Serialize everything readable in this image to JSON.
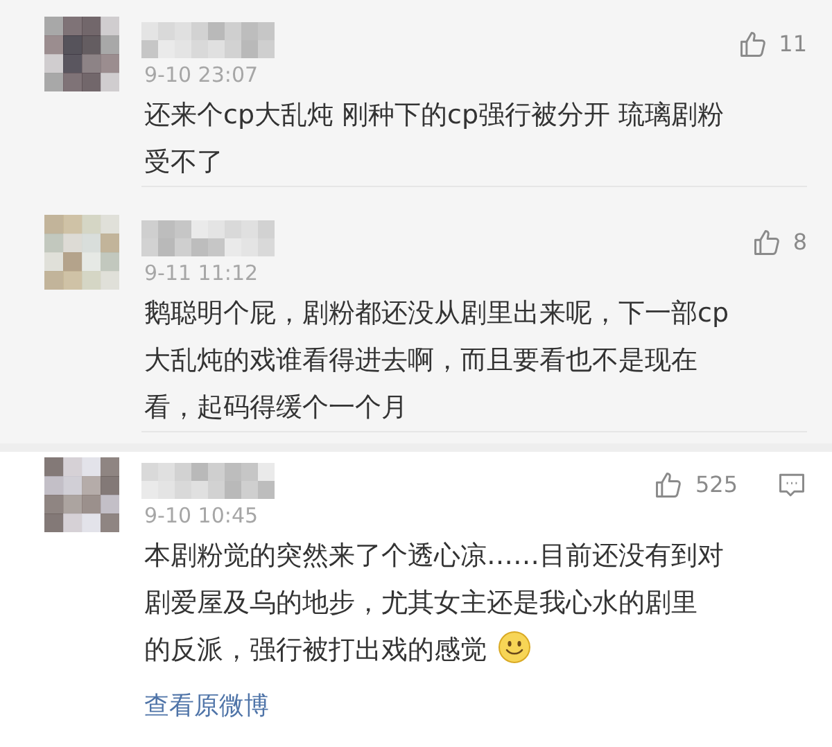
{
  "comments": [
    {
      "kind": "reply",
      "time": "9-10 23:07",
      "likes": "11",
      "lines": [
        "还来个cp大乱炖 刚种下的cp强行被分开 琉璃剧粉",
        "受不了"
      ]
    },
    {
      "kind": "reply",
      "time": "9-11 11:12",
      "likes": "8",
      "lines": [
        "鹅聪明个屁，剧粉都还没从剧里出来呢，下一部cp",
        "大乱炖的戏谁看得进去啊，而且要看也不是现在",
        "看，起码得缓个一个月"
      ]
    },
    {
      "kind": "post",
      "time": "9-10 10:45",
      "likes": "525",
      "lines": [
        "本剧粉觉的突然来了个透心凉……目前还没有到对",
        "剧爱屋及乌的地步，尤其女主还是我心水的剧里",
        "的反派，强行被打出戏的感觉"
      ],
      "smiley": true,
      "comment_button": true,
      "link": "查看原微博"
    }
  ]
}
